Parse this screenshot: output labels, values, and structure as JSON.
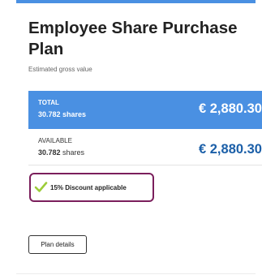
{
  "card": {
    "title": "Employee Share Purchase Plan",
    "subtitle": "Estimated gross value",
    "accent_color": "#4a90e2"
  },
  "total": {
    "label": "TOTAL",
    "shares": "30.782 shares",
    "amount": "€ 2,880.30"
  },
  "available": {
    "label": "AVAILABLE",
    "shares_number": "30.782",
    "shares_unit": "shares",
    "amount": "€ 2,880.30",
    "amount_color": "#1b5fa8"
  },
  "discount": {
    "icon": "check-icon",
    "text": "15% Discount applicable",
    "highlight_color": "#7b1f5c"
  },
  "actions": {
    "plan_details_label": "Plan details"
  }
}
